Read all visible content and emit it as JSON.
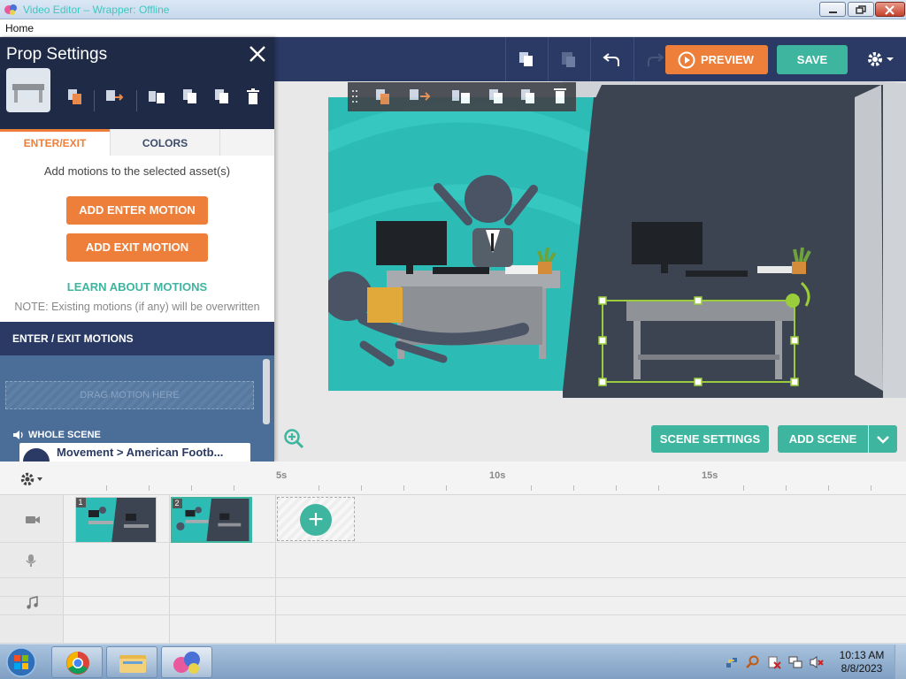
{
  "window": {
    "title": "Video Editor – Wrapper: Offline"
  },
  "menu": {
    "items": [
      "Home"
    ]
  },
  "toolbar": {
    "preview_label": "PREVIEW",
    "save_label": "SAVE"
  },
  "panel": {
    "title": "Prop Settings",
    "tabs": [
      "ENTER/EXIT",
      "COLORS"
    ],
    "hint": "Add motions to the selected asset(s)",
    "add_enter_label": "ADD ENTER MOTION",
    "add_exit_label": "ADD EXIT MOTION",
    "learn_label": "LEARN ABOUT MOTIONS",
    "note": "NOTE: Existing motions (if any) will be overwritten",
    "motions_header": "ENTER / EXIT MOTIONS",
    "drop_zone": "DRAG MOTION HERE",
    "whole_scene_label": "WHOLE SCENE",
    "motion_item": "Movement > American Footb..."
  },
  "stage": {
    "scene_settings_label": "SCENE SETTINGS",
    "add_scene_label": "ADD SCENE"
  },
  "timeline": {
    "marks": [
      "5s",
      "10s",
      "15s"
    ],
    "scenes": [
      {
        "number": "1",
        "selected": false
      },
      {
        "number": "2",
        "selected": true
      }
    ]
  },
  "taskbar": {
    "time": "10:13 AM",
    "date": "8/8/2023"
  },
  "colors": {
    "navy": "#2a3a64",
    "orange": "#ee7f3b",
    "teal": "#3eb59f",
    "stage_teal": "#2dbbb5",
    "dark_room": "#3b4450"
  },
  "icons": [
    "app-icon",
    "minimize-icon",
    "maximize-icon",
    "close-icon",
    "copy-icon",
    "paste-icon",
    "undo-icon",
    "redo-icon",
    "play-icon",
    "gear-icon",
    "replace-icon",
    "add-motion-icon",
    "send-back-icon",
    "copy-icon",
    "paste-icon",
    "delete-icon",
    "zoom-in-icon",
    "camera-icon",
    "microphone-icon",
    "music-note-icon",
    "windows-start-icon",
    "chrome-icon",
    "folder-icon"
  ]
}
